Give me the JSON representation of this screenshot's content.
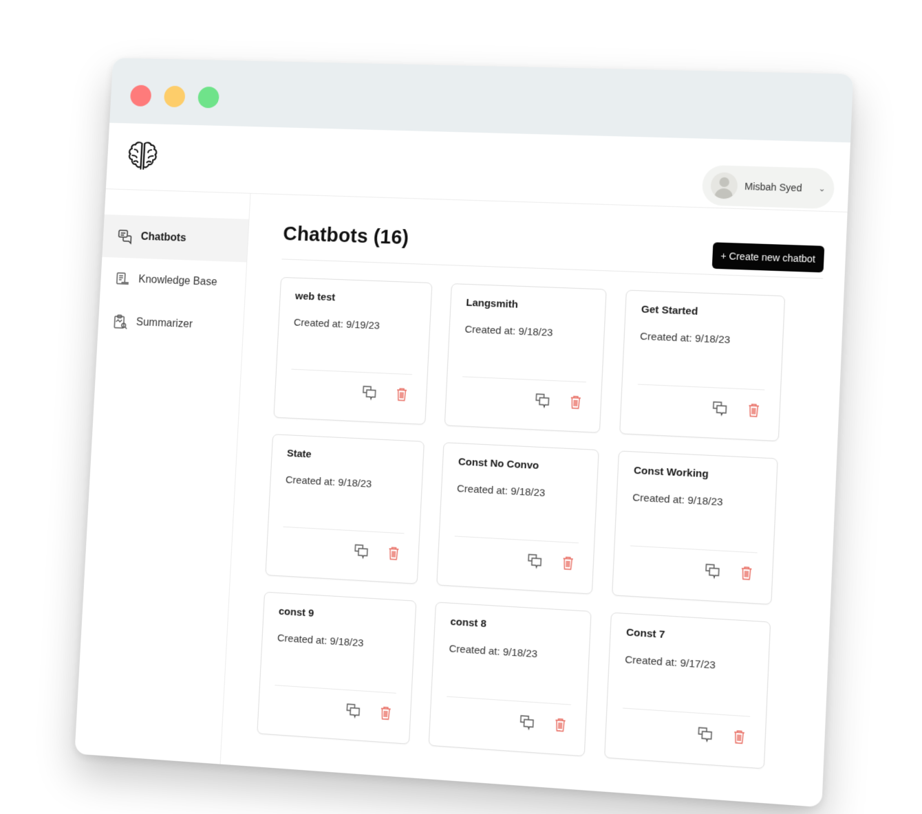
{
  "window": {
    "controls": {
      "close_color": "#fe7b7b",
      "minimize_color": "#fdcd6a",
      "maximize_color": "#6fe38a"
    }
  },
  "app": {
    "logo_icon": "brain-icon",
    "user": {
      "name": "Misbah Syed",
      "avatar_icon": "user-avatar-icon",
      "menu_icon": "chevron-down-icon"
    }
  },
  "sidebar": {
    "items": [
      {
        "label": "Chatbots",
        "icon": "chat-bubbles-icon",
        "active": true
      },
      {
        "label": "Knowledge Base",
        "icon": "document-stack-icon",
        "active": false
      },
      {
        "label": "Summarizer",
        "icon": "clipboard-search-icon",
        "active": false
      }
    ]
  },
  "main": {
    "title": "Chatbots (16)",
    "create_button_label": "+ Create new chatbot",
    "cards": [
      {
        "name": "web test",
        "created": "Created at: 9/19/23"
      },
      {
        "name": "Langsmith",
        "created": "Created at: 9/18/23"
      },
      {
        "name": "Get Started",
        "created": "Created at: 9/18/23"
      },
      {
        "name": "State",
        "created": "Created at: 9/18/23"
      },
      {
        "name": "Const No Convo",
        "created": "Created at: 9/18/23"
      },
      {
        "name": "Const Working",
        "created": "Created at: 9/18/23"
      },
      {
        "name": "const 9",
        "created": "Created at: 9/18/23"
      },
      {
        "name": "const 8",
        "created": "Created at: 9/18/23"
      },
      {
        "name": "Const 7",
        "created": "Created at: 9/17/23"
      }
    ],
    "card_actions": {
      "chat_icon": "chat-icon",
      "delete_icon": "trash-icon",
      "delete_color": "#e86a5f"
    }
  }
}
